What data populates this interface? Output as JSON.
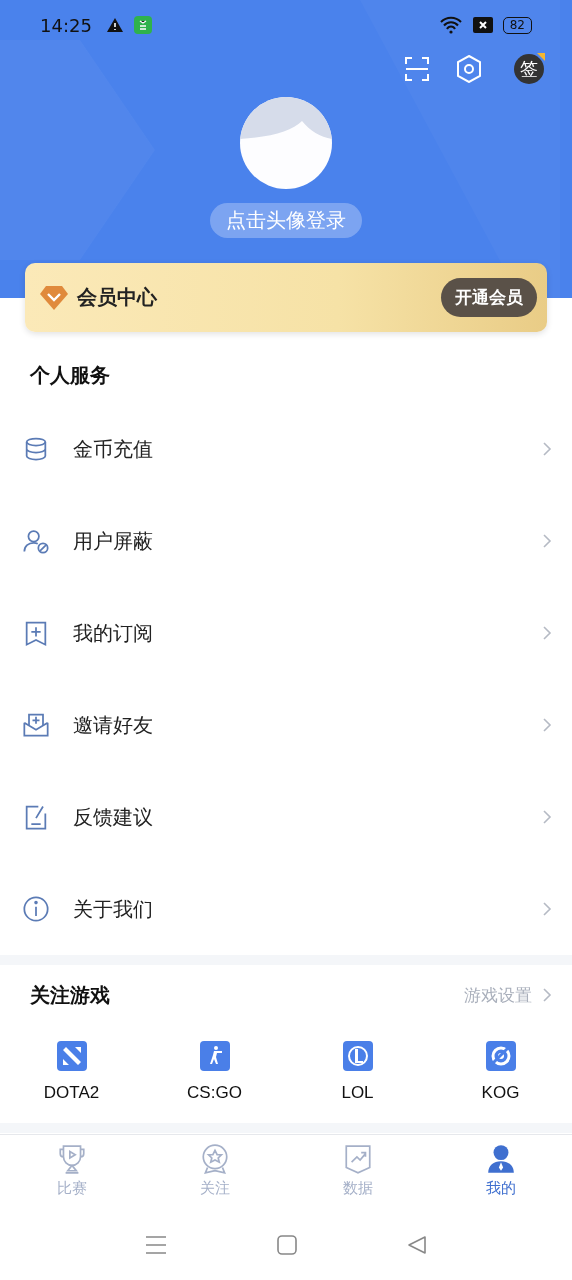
{
  "status_bar": {
    "time": "14:25",
    "battery": "82"
  },
  "header": {
    "sign_in": "签",
    "login_prompt": "点击头像登录"
  },
  "vip_card": {
    "title": "会员中心",
    "button": "开通会员"
  },
  "services": {
    "title": "个人服务",
    "items": [
      {
        "label": "金币充值"
      },
      {
        "label": "用户屏蔽"
      },
      {
        "label": "我的订阅"
      },
      {
        "label": "邀请好友"
      },
      {
        "label": "反馈建议"
      },
      {
        "label": "关于我们"
      }
    ]
  },
  "games": {
    "title": "关注游戏",
    "settings_link": "游戏设置",
    "items": [
      {
        "label": "DOTA2"
      },
      {
        "label": "CS:GO"
      },
      {
        "label": "LOL"
      },
      {
        "label": "KOG"
      }
    ]
  },
  "tab_bar": [
    {
      "label": "比赛",
      "selected": false
    },
    {
      "label": "关注",
      "selected": false
    },
    {
      "label": "数据",
      "selected": false
    },
    {
      "label": "我的",
      "selected": true
    }
  ]
}
